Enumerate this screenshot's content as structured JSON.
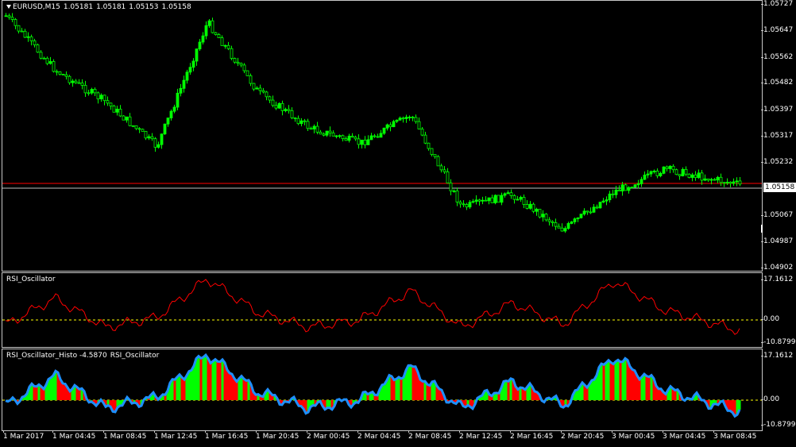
{
  "main_chart": {
    "symbol": "EURUSD,M15",
    "ohlc": [
      "1.05181",
      "1.05181",
      "1.05153",
      "1.05158"
    ],
    "current_price": "1.05158",
    "colors": {
      "bull": "#00ff00",
      "bear": "#00ff00",
      "bid_line": "#c0c0c0",
      "ask_line": "#ff0000"
    },
    "price_scale": [
      "1.05727",
      "1.05647",
      "1.05562",
      "1.05482",
      "1.05397",
      "1.05317",
      "1.05232",
      "1.05067",
      "1.04987",
      "1.04902"
    ]
  },
  "rsi_pane": {
    "title": "RSI_Oscillator",
    "scale": [
      "17.1612",
      "0.00",
      "-10.8799"
    ],
    "colors": {
      "line": "#ff0000",
      "zero_line": "#ffff00"
    }
  },
  "histo_pane": {
    "title_parts": [
      "RSI_Oscillator_Histo -4.5870",
      "RSI_Oscillator"
    ],
    "scale": [
      "17.1612",
      "0.00",
      "-10.8799"
    ],
    "colors": {
      "up": "#00ff00",
      "down": "#ff0000",
      "line": "#1e90ff",
      "zero_line": "#ffff00"
    }
  },
  "time_axis": [
    "1 Mar 2017",
    "1 Mar 04:45",
    "1 Mar 08:45",
    "1 Mar 12:45",
    "1 Mar 16:45",
    "1 Mar 20:45",
    "2 Mar 00:45",
    "2 Mar 04:45",
    "2 Mar 08:45",
    "2 Mar 12:45",
    "2 Mar 16:45",
    "2 Mar 20:45",
    "3 Mar 00:45",
    "3 Mar 04:45",
    "3 Mar 08:45"
  ],
  "chart_data": {
    "type": "line",
    "x": [
      "1 Mar 2017",
      "1 Mar 04:45",
      "1 Mar 08:45",
      "1 Mar 12:45",
      "1 Mar 16:45",
      "1 Mar 20:45",
      "2 Mar 00:45",
      "2 Mar 04:45",
      "2 Mar 08:45",
      "2 Mar 12:45",
      "2 Mar 16:45",
      "2 Mar 20:45",
      "3 Mar 00:45",
      "3 Mar 04:45",
      "3 Mar 08:45"
    ],
    "series": [
      {
        "name": "EURUSD,M15",
        "values": [
          1.0569,
          1.0552,
          1.0542,
          1.0528,
          1.0567,
          1.0545,
          1.0534,
          1.0529,
          1.0538,
          1.0509,
          1.0513,
          1.0502,
          1.0514,
          1.0521,
          1.0516
        ]
      },
      {
        "name": "RSI_Oscillator",
        "values": [
          -2,
          9,
          -3,
          1,
          17,
          3,
          -3,
          0,
          12,
          -3,
          7,
          -2,
          16,
          4,
          -4.587
        ]
      }
    ],
    "ylim": [
      1.04902,
      1.05727
    ]
  }
}
